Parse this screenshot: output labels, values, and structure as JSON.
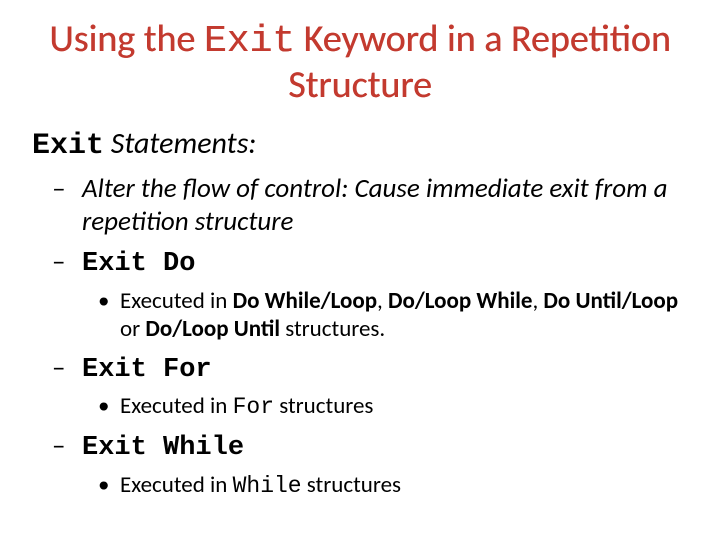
{
  "title": {
    "pre": "Using the ",
    "code": "Exit",
    "post": " Keyword in a Repetition Structure"
  },
  "section": {
    "code": "Exit",
    "rest": " Statements:"
  },
  "items": [
    {
      "type": "italic-text",
      "text": "Alter the flow of control: Cause immediate exit from a repetition structure"
    },
    {
      "type": "code-head",
      "code": "Exit Do",
      "sub": {
        "pre": "Executed in ",
        "bold": "Do While/Loop",
        "mid1": ", ",
        "bold2": "Do/Loop While",
        "mid2": ", ",
        "bold3": "Do Until/Loop",
        "mid3": " or ",
        "bold4": "Do/Loop Until",
        "post": " structures."
      }
    },
    {
      "type": "code-head",
      "code": "Exit For",
      "sub_simple": {
        "pre": "Executed in ",
        "mono": "For",
        "post": " structures"
      }
    },
    {
      "type": "code-head",
      "code": "Exit While",
      "sub_simple": {
        "pre": "Executed in ",
        "mono": "While",
        "post": " structures"
      }
    }
  ]
}
